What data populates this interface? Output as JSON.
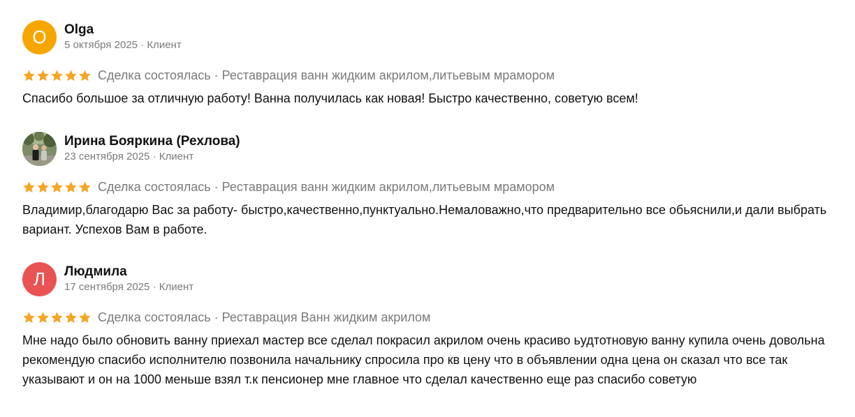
{
  "reviews": [
    {
      "author": "Olga",
      "avatar_letter": "O",
      "avatar_color": "#f7a600",
      "date": "5 октября 2025",
      "role": "Клиент",
      "rating": 5,
      "deal_status": "Сделка состоялась",
      "service": "Реставрация ванн жидким акрилом,литьевым мрамором",
      "text": "Спасибо большое за отличную работу! Ванна получилась как новая! Быстро качественно, советую всем!"
    },
    {
      "author": "Ирина Бояркина (Рехлова)",
      "avatar_letter": "",
      "avatar_color": "#6f7d5e",
      "date": "23 сентября 2025",
      "role": "Клиент",
      "rating": 5,
      "deal_status": "Сделка состоялась",
      "service": "Реставрация ванн жидким акрилом,литьевым мрамором",
      "text": "Владимир,благодарю Вас за работу- быстро,качественно,пунктуально.Немаловажно,что предварительно все обьяснили,и дали выбрать вариант. Успехов Вам в работе."
    },
    {
      "author": "Людмила",
      "avatar_letter": "Л",
      "avatar_color": "#ea5353",
      "date": "17 сентября 2025",
      "role": "Клиент",
      "rating": 5,
      "deal_status": "Сделка состоялась",
      "service": "Реставрация Ванн жидким акрилом",
      "text": "Мне надо было обновить ванну приехал мастер все сделал покрасил акрилом очень красиво ьудтотновую ванну купила очень довольна рекомендую спасибо исполнителю позвонила начальнику спросила про кв цену что в объявлении одна цена он сказал что все так указывают и он на 1000 меньше взял т.к пенсионер мне главное что сделал качественно еще раз спасибо советую"
    }
  ],
  "separator": " · ",
  "star_color": "#f5a623"
}
